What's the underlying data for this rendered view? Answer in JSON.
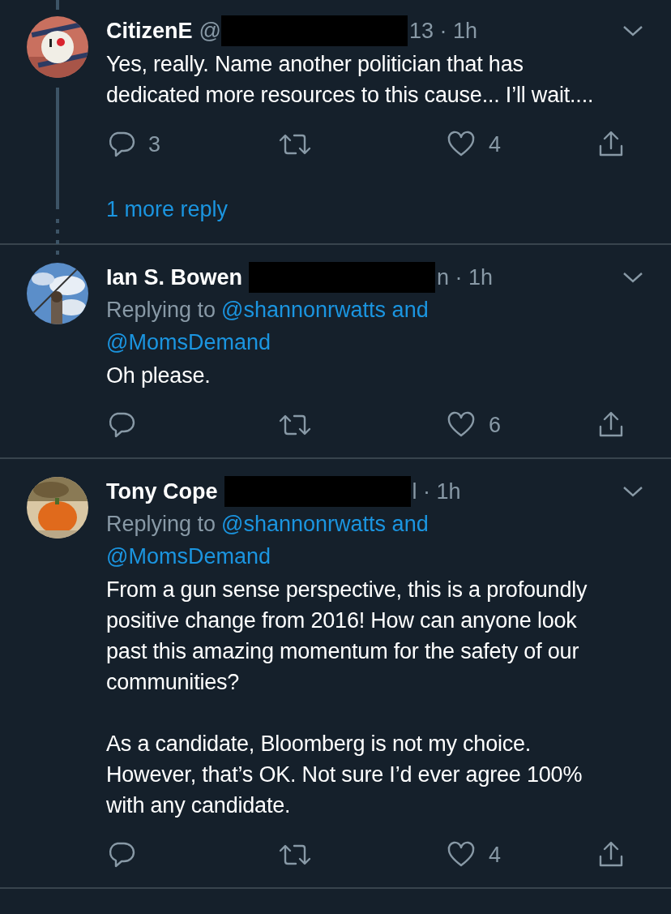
{
  "tweets": [
    {
      "name": "CitizenE",
      "handle": "@",
      "meta": "13 · 1h",
      "thread": true,
      "body": [
        "Yes, really. Name another politician that has dedicated more resources to this cause... I’ll wait...."
      ],
      "replies": "3",
      "likes": "4",
      "more_replies": "1 more reply"
    },
    {
      "name": "Ian S. Bowen",
      "meta": "n · 1h",
      "thread": false,
      "replying": {
        "label": "Replying to",
        "mentions": [
          "@shannonrwatts and",
          "@MomsDemand"
        ]
      },
      "body": [
        "Oh please."
      ],
      "likes": "6"
    },
    {
      "name": "Tony Cope",
      "meta": "l · 1h",
      "thread": false,
      "replying": {
        "label": "Replying to",
        "mentions": [
          "@shannonrwatts and",
          "@MomsDemand"
        ]
      },
      "body": [
        "From a gun sense perspective, this is a profoundly positive change from 2016! How can anyone look past this amazing momentum for the safety of our communities?",
        "As a candidate, Bloomberg is not my choice. However, that’s OK. Not sure I’d ever agree 100% with any candidate."
      ],
      "likes": "4"
    }
  ]
}
